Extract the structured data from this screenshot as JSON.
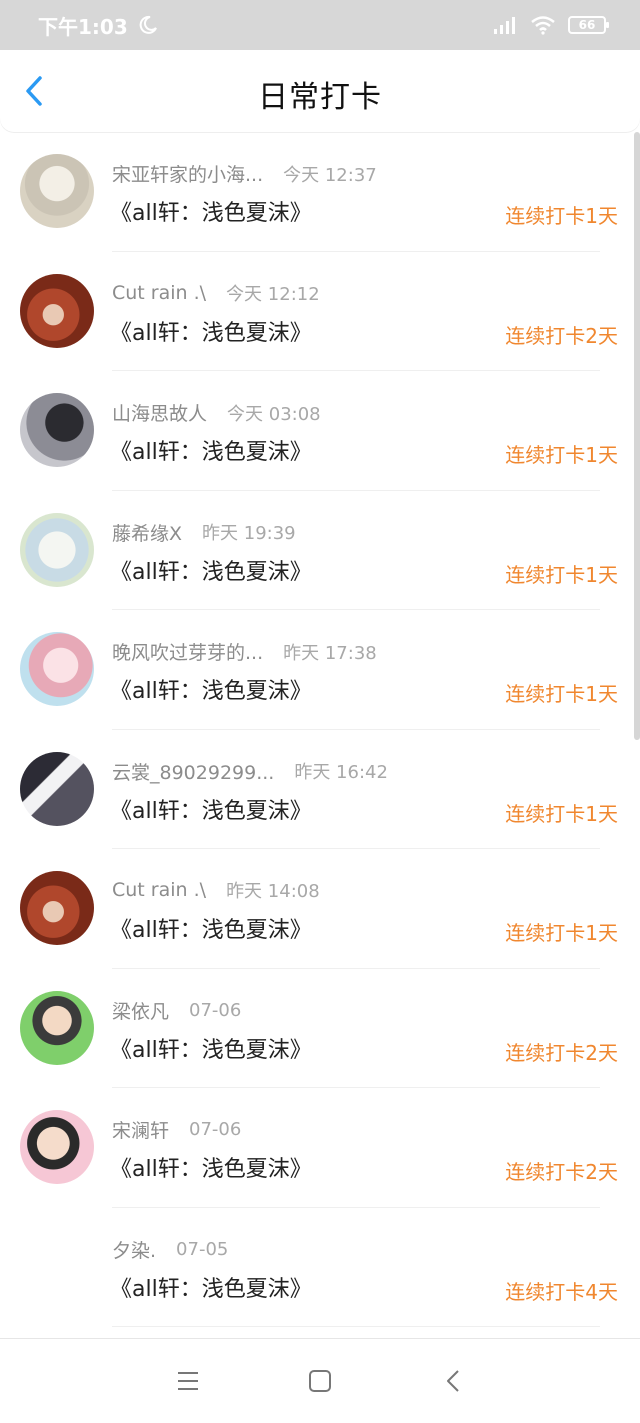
{
  "status_bar": {
    "time": "下午1:03",
    "battery": "66",
    "icons": [
      "moon-icon",
      "signal-icon",
      "wifi-icon",
      "battery-icon"
    ]
  },
  "header": {
    "title": "日常打卡",
    "back_icon": "chevron-left-icon"
  },
  "colors": {
    "accent": "#f0872f",
    "back": "#2b9af3"
  },
  "items": [
    {
      "name": "宋亚轩家的小海...",
      "time": "今天 12:37",
      "book": "《all轩：浅色夏沫》",
      "streak": "连续打卡1天",
      "avatar": "a1"
    },
    {
      "name": "Cut rain .\\",
      "time": "今天 12:12",
      "book": "《all轩：浅色夏沫》",
      "streak": "连续打卡2天",
      "avatar": "a2"
    },
    {
      "name": "山海思故人",
      "time": "今天 03:08",
      "book": "《all轩：浅色夏沫》",
      "streak": "连续打卡1天",
      "avatar": "a3"
    },
    {
      "name": "藤希缘X",
      "time": "昨天 19:39",
      "book": "《all轩：浅色夏沫》",
      "streak": "连续打卡1天",
      "avatar": "a4"
    },
    {
      "name": "晚风吹过芽芽的...",
      "time": "昨天 17:38",
      "book": "《all轩：浅色夏沫》",
      "streak": "连续打卡1天",
      "avatar": "a5"
    },
    {
      "name": "云裳_89029299...",
      "time": "昨天 16:42",
      "book": "《all轩：浅色夏沫》",
      "streak": "连续打卡1天",
      "avatar": "a6"
    },
    {
      "name": "Cut rain .\\",
      "time": "昨天 14:08",
      "book": "《all轩：浅色夏沫》",
      "streak": "连续打卡1天",
      "avatar": "a2"
    },
    {
      "name": "梁依凡",
      "time": "07-06",
      "book": "《all轩：浅色夏沫》",
      "streak": "连续打卡2天",
      "avatar": "a7"
    },
    {
      "name": "宋澜轩",
      "time": "07-06",
      "book": "《all轩：浅色夏沫》",
      "streak": "连续打卡2天",
      "avatar": "a8"
    },
    {
      "name": "夕染.",
      "time": "07-05",
      "book": "《all轩：浅色夏沫》",
      "streak": "连续打卡4天",
      "avatar": "none"
    }
  ],
  "nav": {
    "icons": [
      "menu-icon",
      "home-square-icon",
      "back-triangle-icon"
    ]
  }
}
